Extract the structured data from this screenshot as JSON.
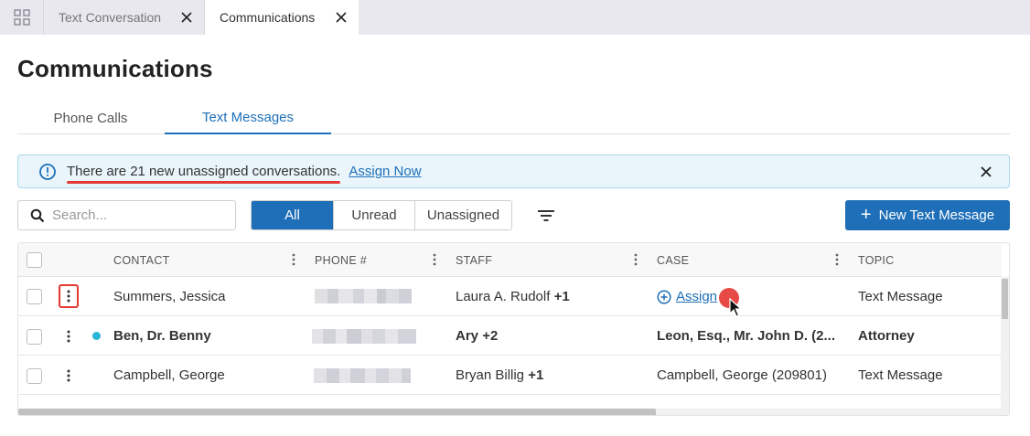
{
  "tabs": [
    {
      "label": "Text Conversation",
      "active": false
    },
    {
      "label": "Communications",
      "active": true
    }
  ],
  "page": {
    "title": "Communications",
    "subtabs": [
      "Phone Calls",
      "Text Messages"
    ],
    "active_subtab": "Text Messages"
  },
  "banner": {
    "message": "There are 21 new unassigned conversations.",
    "link": "Assign Now"
  },
  "toolbar": {
    "search_placeholder": "Search...",
    "filters": [
      "All",
      "Unread",
      "Unassigned"
    ],
    "active_filter": "All",
    "new_button": "New Text Message"
  },
  "table": {
    "columns": [
      "CONTACT",
      "PHONE #",
      "STAFF",
      "CASE",
      "TOPIC"
    ],
    "rows": [
      {
        "contact": "Summers, Jessica",
        "phone": "",
        "staff": "Laura A. Rudolf",
        "staff_extra": "+1",
        "case": "Assign",
        "topic": "Text Message",
        "unread": false
      },
      {
        "contact": "Ben, Dr. Benny",
        "phone": "",
        "staff": "Ary",
        "staff_extra": "+2",
        "case": "Leon, Esq., Mr. John D. (2...",
        "topic": "Attorney",
        "unread": true
      },
      {
        "contact": "Campbell, George",
        "phone": "",
        "staff": "Bryan Billig",
        "staff_extra": "+1",
        "case": "Campbell, George (209801)",
        "topic": "Text Message",
        "unread": false
      }
    ]
  },
  "colors": {
    "accent": "#1e6fb8",
    "highlight": "#e53935",
    "unread_dot": "#29b6d8",
    "banner_bg": "#e9f5fb"
  }
}
